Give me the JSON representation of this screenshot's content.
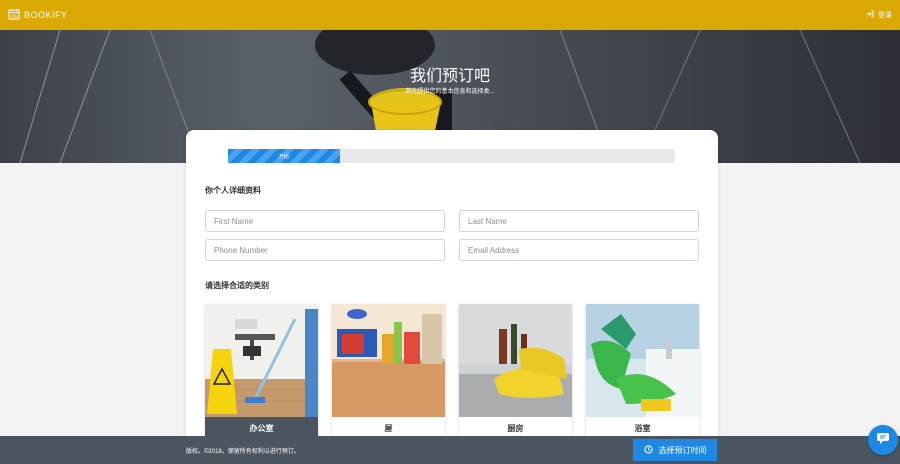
{
  "header": {
    "brand": "BOOKIFY",
    "login_label": "登录"
  },
  "hero": {
    "title": "我们预订吧",
    "subtitle": "首先提供您的基本信息和选择类..."
  },
  "progress": {
    "label": "开始",
    "value_percent": 25
  },
  "personal": {
    "title": "你个人详细资料",
    "first_name_placeholder": "First Name",
    "last_name_placeholder": "Last Name",
    "phone_placeholder": "Phone Number",
    "email_placeholder": "Email Address"
  },
  "categories": {
    "title": "请选择合适的类别",
    "items": [
      {
        "label": "办公室",
        "selected": true
      },
      {
        "label": "屋",
        "selected": false
      },
      {
        "label": "厨房",
        "selected": false
      },
      {
        "label": "浴室",
        "selected": false
      }
    ]
  },
  "footer": {
    "copyright": "版权。©2018。保留所有权利以进行预订。",
    "select_time_label": "选择预订时间"
  },
  "icons": {
    "logo": "calendar-icon",
    "login": "sign-in-icon",
    "clock": "clock-icon",
    "chat": "chat-icon"
  },
  "colors": {
    "topbar": "#daa904",
    "accent": "#1e88e5",
    "footer": "#4b5560"
  }
}
